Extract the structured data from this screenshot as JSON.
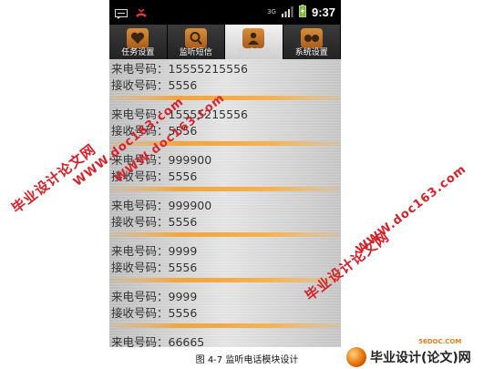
{
  "status_bar": {
    "time": "9:37",
    "network_label": "3G",
    "icons": [
      "sms-icon",
      "missed-call-icon",
      "3g-icon",
      "signal-icon",
      "battery-icon"
    ]
  },
  "tabs": [
    {
      "label": "任务设置",
      "icon": "heart-icon",
      "selected": false
    },
    {
      "label": "监听短信",
      "icon": "magnifier-icon",
      "selected": false
    },
    {
      "label": "监听电话",
      "icon": "person-icon",
      "selected": true
    },
    {
      "label": "系统设置",
      "icon": "dots-icon",
      "selected": false
    }
  ],
  "records": [
    {
      "caller": "来电号码：15555215556",
      "receiver": "接收号码：5556"
    },
    {
      "caller": "来电号码：15555215556",
      "receiver": "接收号码：5556"
    },
    {
      "caller": "来电号码：999900",
      "receiver": "接收号码：5556"
    },
    {
      "caller": "来电号码：999900",
      "receiver": "接收号码：5556"
    },
    {
      "caller": "来电号码：9999",
      "receiver": "接收号码：5556"
    },
    {
      "caller": "来电号码：9999",
      "receiver": "接收号码：5556"
    },
    {
      "caller": "来电号码：66665",
      "receiver": ""
    }
  ],
  "watermarks": {
    "site_cn": "毕业设计论文网",
    "site_url": "WWW.doc163.com"
  },
  "caption": "图 4-7 监听电话模块设计",
  "logo": {
    "small_text": "56DOC.COM",
    "text": "毕业设计(论文)网"
  },
  "colors": {
    "accent_orange": "#f1a53e",
    "tab_icon": "#c7772a",
    "watermark_red": "#d4212a"
  }
}
